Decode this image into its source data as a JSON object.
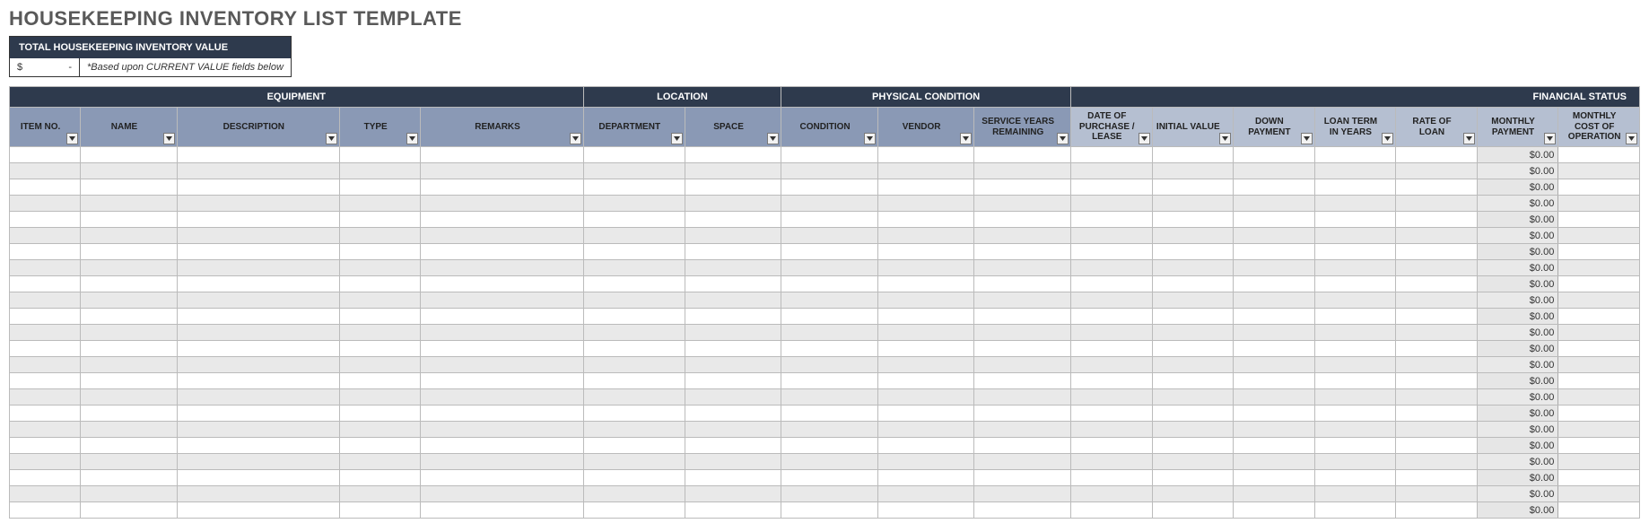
{
  "title": "HOUSEKEEPING INVENTORY LIST TEMPLATE",
  "totalbox": {
    "header": "TOTAL HOUSEKEEPING INVENTORY VALUE",
    "currency": "$",
    "value": "-",
    "note": "*Based upon CURRENT VALUE fields below"
  },
  "groups": {
    "equipment": "EQUIPMENT",
    "location": "LOCATION",
    "physical": "PHYSICAL CONDITION",
    "financial": "FINANCIAL STATUS"
  },
  "columns": {
    "item_no": "ITEM NO.",
    "name": "NAME",
    "description": "DESCRIPTION",
    "type": "TYPE",
    "remarks": "REMARKS",
    "department": "DEPARTMENT",
    "space": "SPACE",
    "condition": "CONDITION",
    "vendor": "VENDOR",
    "service_years": "SERVICE YEARS REMAINING",
    "date_purchase": "DATE OF PURCHASE / LEASE",
    "initial_value": "INITIAL VALUE",
    "down_payment": "DOWN PAYMENT",
    "loan_term": "LOAN TERM IN YEARS",
    "rate_of_loan": "RATE OF LOAN",
    "monthly_payment": "MONTHLY PAYMENT",
    "monthly_cost_op": "MONTHLY COST OF OPERATION"
  },
  "rows": [
    {
      "monthly_payment": "$0.00"
    },
    {
      "monthly_payment": "$0.00"
    },
    {
      "monthly_payment": "$0.00"
    },
    {
      "monthly_payment": "$0.00"
    },
    {
      "monthly_payment": "$0.00"
    },
    {
      "monthly_payment": "$0.00"
    },
    {
      "monthly_payment": "$0.00"
    },
    {
      "monthly_payment": "$0.00"
    },
    {
      "monthly_payment": "$0.00"
    },
    {
      "monthly_payment": "$0.00"
    },
    {
      "monthly_payment": "$0.00"
    },
    {
      "monthly_payment": "$0.00"
    },
    {
      "monthly_payment": "$0.00"
    },
    {
      "monthly_payment": "$0.00"
    },
    {
      "monthly_payment": "$0.00"
    },
    {
      "monthly_payment": "$0.00"
    },
    {
      "monthly_payment": "$0.00"
    },
    {
      "monthly_payment": "$0.00"
    },
    {
      "monthly_payment": "$0.00"
    },
    {
      "monthly_payment": "$0.00"
    },
    {
      "monthly_payment": "$0.00"
    },
    {
      "monthly_payment": "$0.00"
    },
    {
      "monthly_payment": "$0.00"
    }
  ]
}
